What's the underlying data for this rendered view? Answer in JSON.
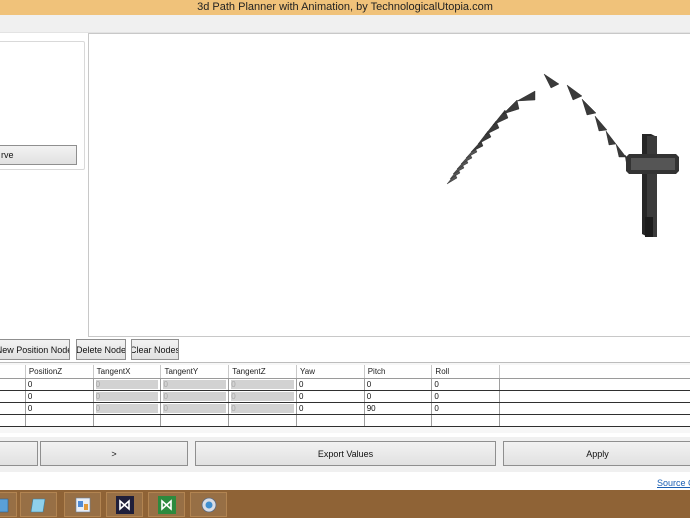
{
  "window": {
    "title": "3d Path Planner with Animation, by TechnologicalUtopia.com"
  },
  "left_panel": {
    "curve_button_label": "rve"
  },
  "node_buttons": {
    "new_position_node": "New Position Node",
    "delete_node": "Delete Node",
    "clear_nodes": "Clear Nodes"
  },
  "grid": {
    "columns": [
      "",
      "PositionZ",
      "TangentX",
      "TangentY",
      "TangentZ",
      "Yaw",
      "Pitch",
      "Roll"
    ],
    "rows": [
      [
        "",
        "0",
        "0",
        "0",
        "0",
        "0",
        "0",
        "0"
      ],
      [
        "",
        "0",
        "0",
        "0",
        "0",
        "0",
        "0",
        "0"
      ],
      [
        "",
        "0",
        "0",
        "0",
        "0",
        "0",
        "90",
        "0"
      ],
      [
        "",
        "",
        "",
        "",
        "",
        "",
        "",
        ""
      ]
    ]
  },
  "bottom_buttons": {
    "next_label": ">",
    "export_label": "Export Values",
    "apply_label": "Apply"
  },
  "links": {
    "source": "Source C"
  },
  "colors": {
    "title_bar": "#f0c27a",
    "taskbar": "#8f6336",
    "model": "#3a3a3a"
  },
  "taskbar_icons": [
    "file-explorer-icon",
    "notepad-icon",
    "paint-icon",
    "visual-studio-icon",
    "visual-studio-express-icon",
    "app-window-icon"
  ]
}
